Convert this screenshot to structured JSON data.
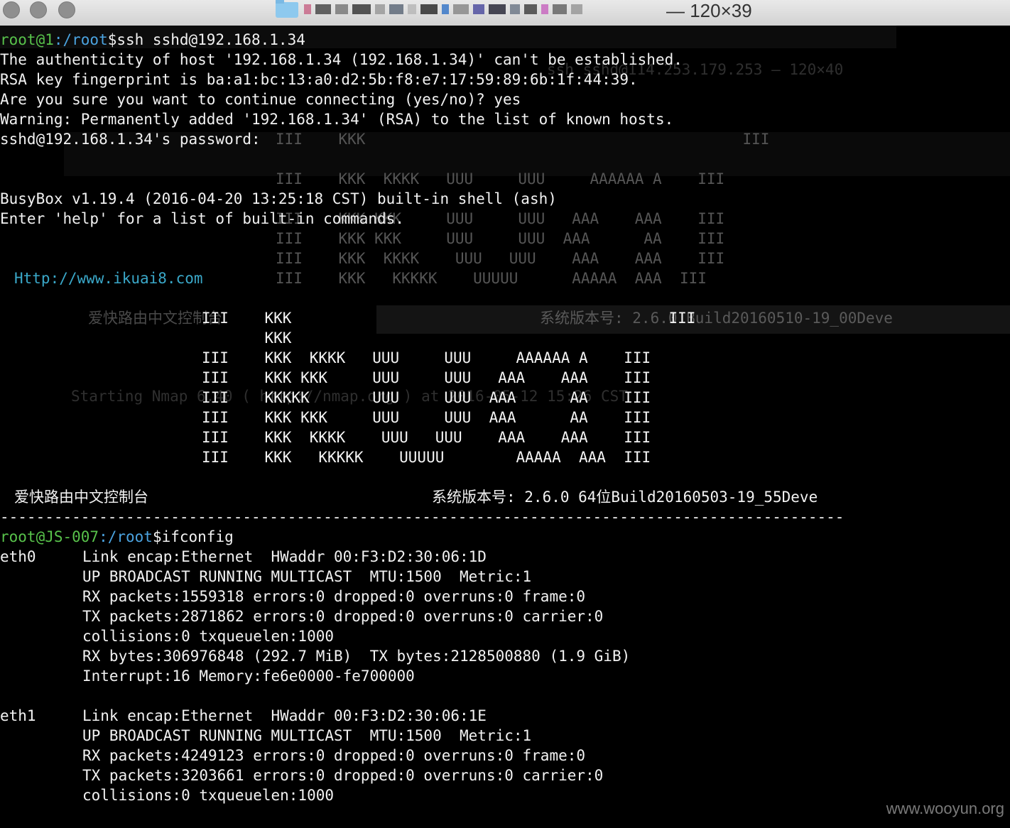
{
  "window": {
    "title": "— 120×39"
  },
  "prompts": {
    "first": {
      "user": "root@1",
      "path": ":/root",
      "command": "$ssh sshd@192.168.1.34"
    },
    "second": {
      "user": "root@JS-007",
      "path": ":/root",
      "command": "$ifconfig"
    }
  },
  "ssh_output": [
    "The authenticity of host '192.168.1.34 (192.168.1.34)' can't be established.",
    "RSA key fingerprint is ba:a1:bc:13:a0:d2:5b:f8:e7:17:59:89:6b:1f:44:39.",
    "Are you sure you want to continue connecting (yes/no)? yes",
    "Warning: Permanently added '192.168.1.34' (RSA) to the list of known hosts.",
    "sshd@192.168.1.34's password:"
  ],
  "busybox": [
    "BusyBox v1.19.4 (2016-04-20 13:25:18 CST) built-in shell (ash)",
    "Enter 'help' for a list of built-in commands."
  ],
  "banner_url": "Http://www.ikuai8.com",
  "ascii_art": [
    "III    KKK                                          III",
    "       KKK",
    "III    KKK  KKKK   UUU     UUU     AAAAAA A    III",
    "III    KKK KKK     UUU     UUU   AAA    AAA    III",
    "III    KKKKK       UUU     UUU  AAA      AA    III",
    "III    KKK KKK     UUU     UUU  AAA      AA    III",
    "III    KKK  KKKK    UUU   UUU    AAA    AAA    III",
    "III    KKK   KKKKK    UUUUU        AAAAA  AAA  III"
  ],
  "console": {
    "name": "爱快路由中文控制台",
    "version": "系统版本号: 2.6.0 64位Build20160503-19_55Deve"
  },
  "divider": "-----------------------------------------------------------------------------------------------------------------------",
  "ifconfig": [
    {
      "iface": "eth0",
      "lines": [
        "Link encap:Ethernet  HWaddr 00:F3:D2:30:06:1D",
        "UP BROADCAST RUNNING MULTICAST  MTU:1500  Metric:1",
        "RX packets:1559318 errors:0 dropped:0 overruns:0 frame:0",
        "TX packets:2871862 errors:0 dropped:0 overruns:0 carrier:0",
        "collisions:0 txqueuelen:1000",
        "RX bytes:306976848 (292.7 MiB)  TX bytes:2128500880 (1.9 GiB)",
        "Interrupt:16 Memory:fe6e0000-fe700000"
      ]
    },
    {
      "iface": "eth1",
      "lines": [
        "Link encap:Ethernet  HWaddr 00:F3:D2:30:06:1E",
        "UP BROADCAST RUNNING MULTICAST  MTU:1500  Metric:1",
        "RX packets:4249123 errors:0 dropped:0 overruns:0 frame:0",
        "TX packets:3203661 errors:0 dropped:0 overruns:0 carrier:0",
        "collisions:0 txqueuelen:1000"
      ]
    }
  ],
  "background": {
    "top_right_title": "ssh sshd@114.253.179.253 — 120×40",
    "nmap_header": "Starting Nmap 6.40 ( http://nmap.org ) at 2016-05-12 15:26 CST",
    "console_version": "系统版本号: 2.6.0 Build20160510-19_00Deve",
    "console_name": "爱快路由中文控制台"
  },
  "watermark": "www.wooyun.org",
  "colors": {
    "prompt_user": "#58c24b",
    "prompt_path": "#4ba3e0",
    "url": "#3aa8c9",
    "text": "#f2f2f2"
  }
}
